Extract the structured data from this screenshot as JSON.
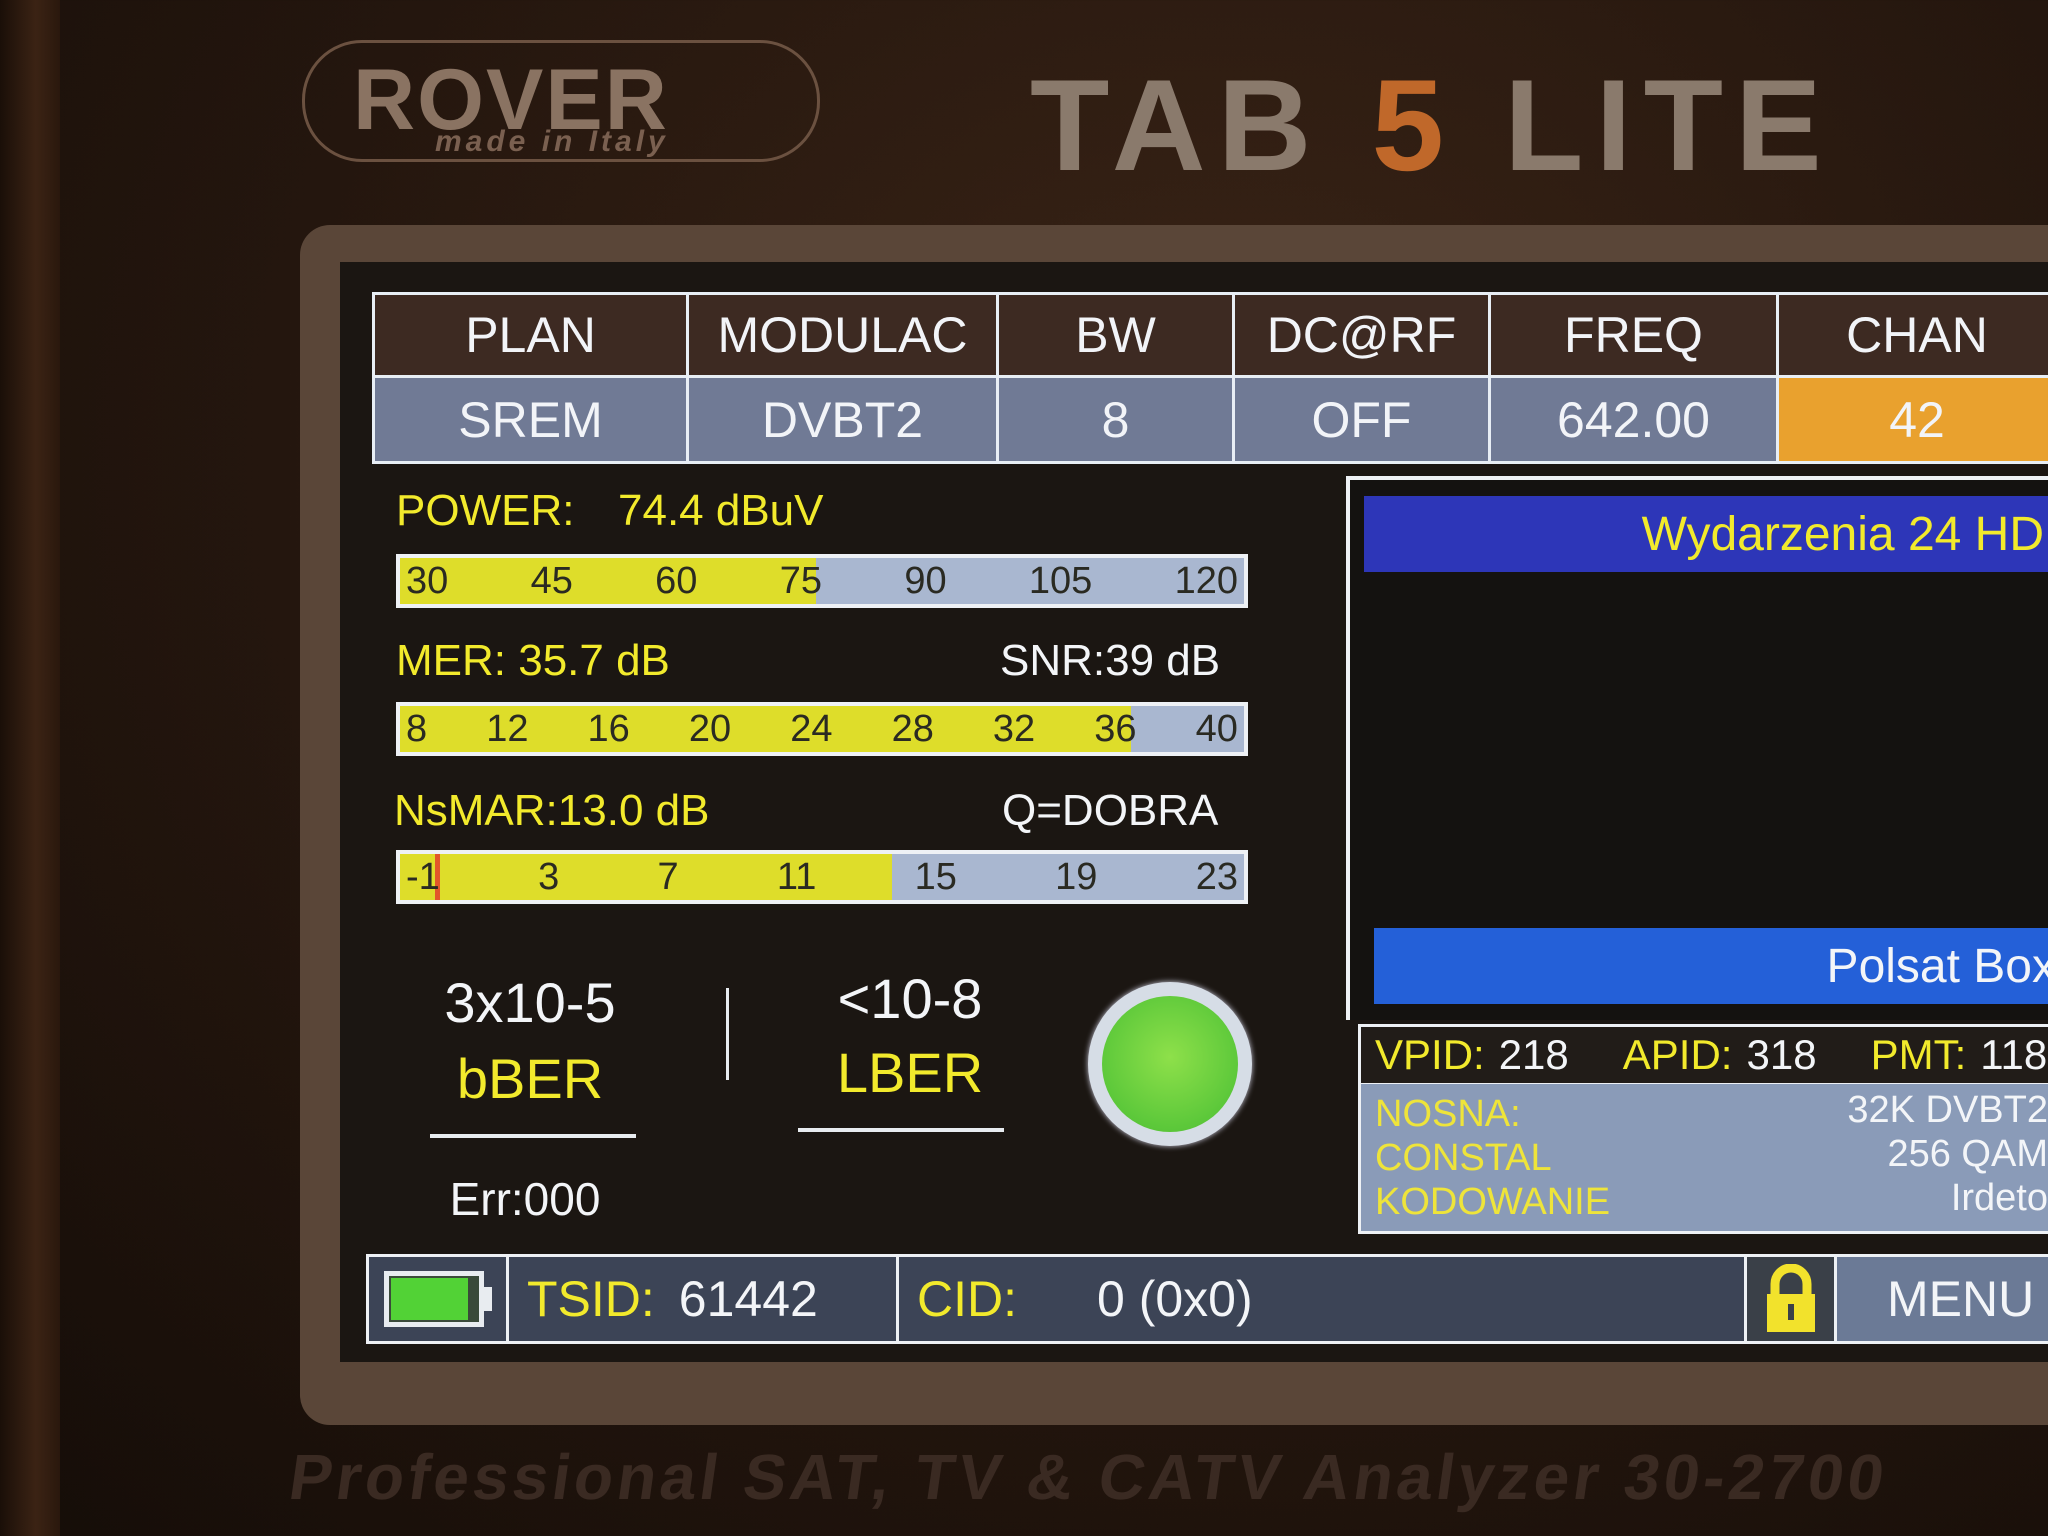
{
  "device": {
    "brand": "ROVER",
    "brand_sub": "made in Italy",
    "model_prefix": "TAB",
    "model_number": "5",
    "model_suffix": "LITE",
    "tagline": "Professional SAT, TV & CATV Analyzer 30-2700"
  },
  "header": {
    "columns": [
      {
        "label": "PLAN",
        "value": "SREM"
      },
      {
        "label": "MODULAC",
        "value": "DVBT2"
      },
      {
        "label": "BW",
        "value": "8"
      },
      {
        "label": "DC@RF",
        "value": "OFF"
      },
      {
        "label": "FREQ",
        "value": "642.00"
      },
      {
        "label": "CHAN",
        "value": "42",
        "active": true
      }
    ]
  },
  "measurements": {
    "power": {
      "label": "POWER:",
      "value": "74.4 dBuV",
      "scale": [
        "30",
        "45",
        "60",
        "75",
        "90",
        "105",
        "120"
      ],
      "min": 30,
      "max": 120,
      "reading": 74.4
    },
    "mer": {
      "label": "MER: 35.7 dB",
      "snr": "SNR:39 dB",
      "scale": [
        "8",
        "12",
        "16",
        "20",
        "24",
        "28",
        "32",
        "36",
        "40"
      ],
      "min": 8,
      "max": 40,
      "reading": 35.7
    },
    "nsmar": {
      "label": "NsMAR:13.0 dB",
      "quality": "Q=DOBRA",
      "scale": [
        "-1",
        "3",
        "7",
        "11",
        "15",
        "19",
        "23"
      ],
      "min": -1,
      "max": 23,
      "reading": 13.0,
      "threshold": 0
    }
  },
  "ber": {
    "bber_value": "3x10-5",
    "bber_label": "bBER",
    "lber_value": "<10-8",
    "lber_label": "LBER",
    "errors": "Err:000",
    "lock_status_color": "#5cc83a"
  },
  "service": {
    "name": "Wydarzenia 24 HD",
    "provider": "Polsat Box",
    "vpid_label": "VPID:",
    "vpid": "218",
    "apid_label": "APID:",
    "apid": "318",
    "pmt_label": "PMT:",
    "pmt": "118",
    "info_keys": [
      "NOSNA:",
      "CONSTAL",
      "KODOWANIE"
    ],
    "info_values": [
      "32K DVBT2",
      "256 QAM",
      "Irdeto"
    ]
  },
  "footer": {
    "battery_level": 0.9,
    "tsid_label": "TSID:",
    "tsid": "61442",
    "cid_label": "CID:",
    "cid": "0 (0x0)",
    "menu_label": "MENU"
  },
  "colors": {
    "accent_orange": "#e9a12e",
    "value_yellow": "#f2ea2c",
    "meter_fill": "#dedd2a",
    "service_blue": "#2d36b8",
    "provider_blue": "#2460d8"
  }
}
